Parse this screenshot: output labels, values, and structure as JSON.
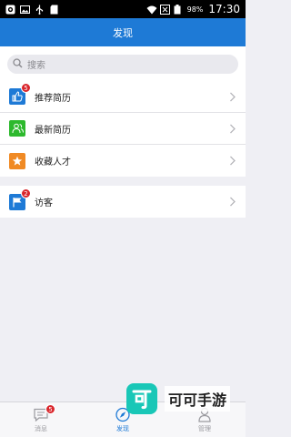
{
  "status_bar": {
    "battery_percent": "98%",
    "time": "17:30",
    "icons": [
      "notification-icon",
      "image-icon",
      "usb-icon",
      "sd-card-icon",
      "wifi-icon",
      "signal-x-icon",
      "battery-icon"
    ]
  },
  "header": {
    "title": "发现"
  },
  "search": {
    "placeholder": "搜索"
  },
  "groups": [
    {
      "items": [
        {
          "label": "推荐简历",
          "icon": "thumbs-up-icon",
          "icon_color": "#1e7ad6",
          "badge": "5"
        },
        {
          "label": "最新简历",
          "icon": "people-icon",
          "icon_color": "#2db92d",
          "badge": ""
        },
        {
          "label": "收藏人才",
          "icon": "star-icon",
          "icon_color": "#f08a24",
          "badge": ""
        }
      ]
    },
    {
      "items": [
        {
          "label": "访客",
          "icon": "flag-icon",
          "icon_color": "#1e7ad6",
          "badge": "2"
        }
      ]
    }
  ],
  "tabs": [
    {
      "label": "消息",
      "icon": "message-icon",
      "badge": "5",
      "active": false
    },
    {
      "label": "发现",
      "icon": "compass-icon",
      "badge": "",
      "active": true
    },
    {
      "label": "管理",
      "icon": "person-icon",
      "badge": "",
      "active": false
    }
  ],
  "watermark": {
    "text": "可可手游",
    "logo_char": "可",
    "logo_color": "#19c7b7"
  },
  "colors": {
    "primary": "#1e7ad6",
    "background": "#efeff4",
    "badge": "#d9262c"
  }
}
